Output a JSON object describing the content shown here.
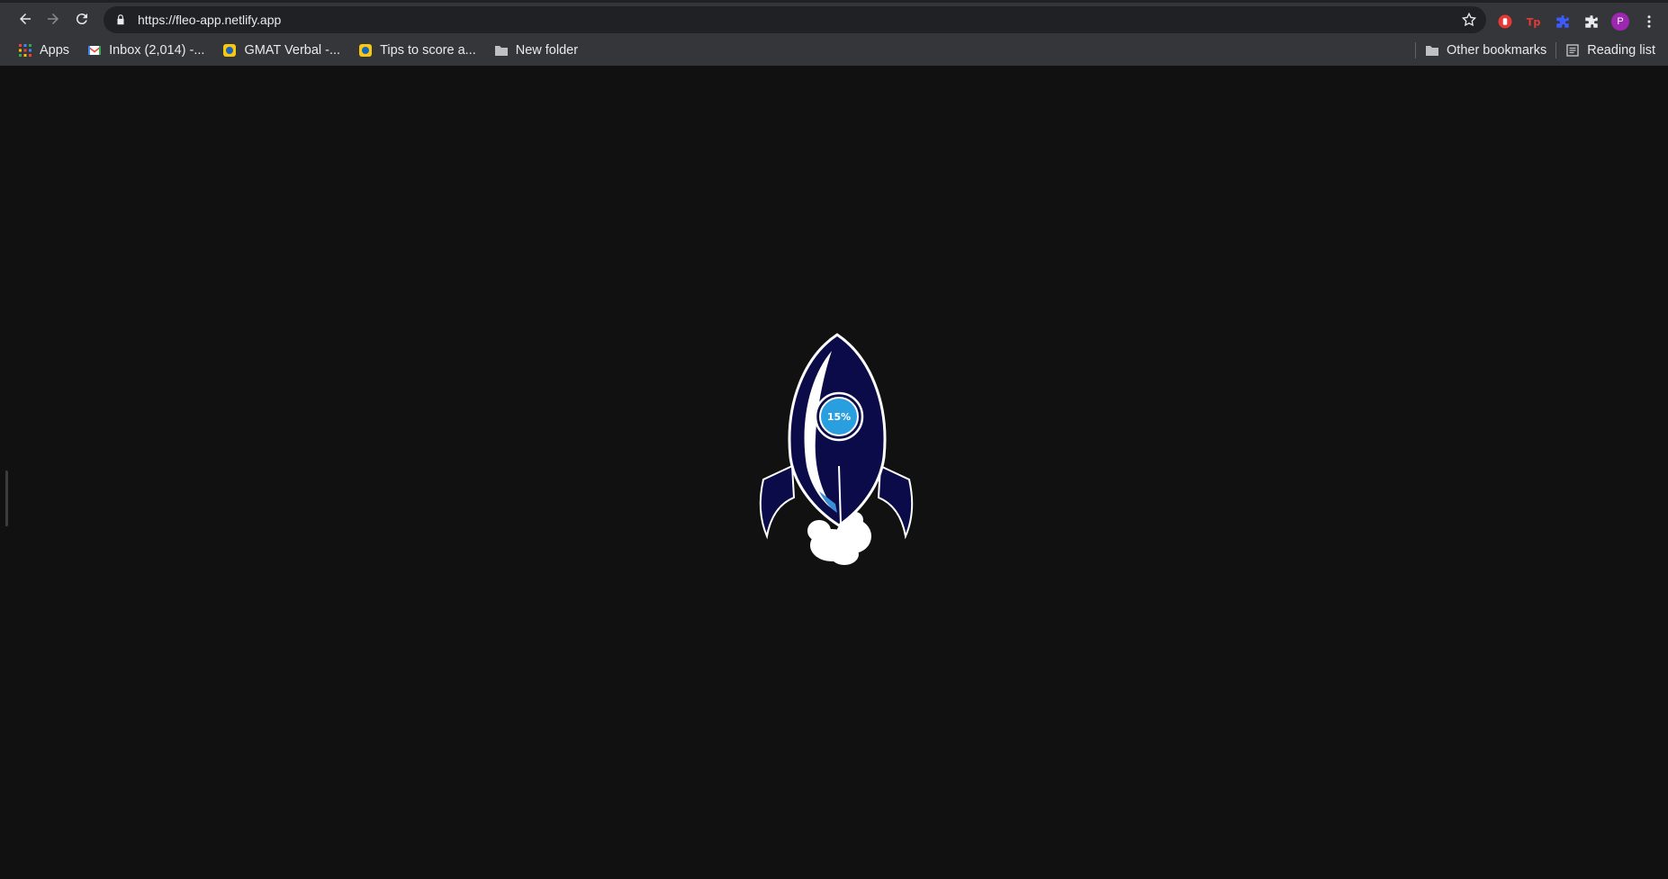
{
  "browser": {
    "url": "https://fleo-app.netlify.app",
    "profile_initial": "P",
    "bookmarks": [
      {
        "label": "Apps",
        "icon": "apps-grid-icon"
      },
      {
        "label": "Inbox (2,014) -...",
        "icon": "gmail-icon"
      },
      {
        "label": "GMAT Verbal -...",
        "icon": "bookmark-site-icon"
      },
      {
        "label": "Tips to score a...",
        "icon": "bookmark-site-icon"
      },
      {
        "label": "New folder",
        "icon": "folder-icon"
      }
    ],
    "other_bookmarks": "Other bookmarks",
    "reading_list": "Reading list"
  },
  "loader": {
    "progress_text": "15%",
    "progress": 0.15,
    "colors": {
      "hull": "#0b0b4a",
      "highlight": "#ffffff",
      "window": "#2a9fe0",
      "accent": "#3a8fd6"
    }
  }
}
